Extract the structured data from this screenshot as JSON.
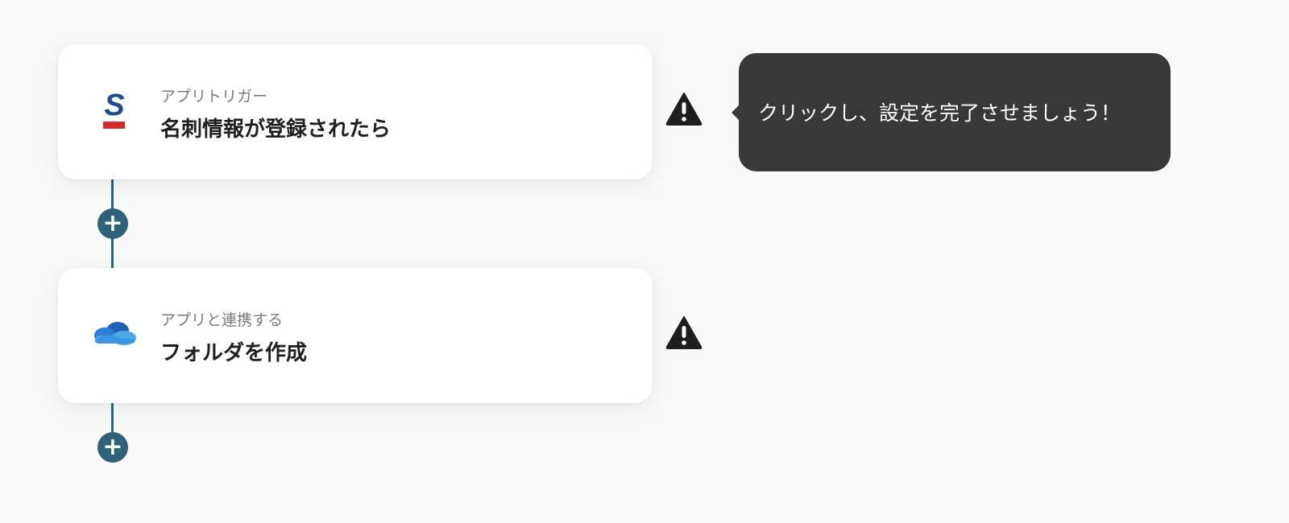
{
  "flow": {
    "steps": [
      {
        "type_label": "アプリトリガー",
        "title": "名刺情報が登録されたら",
        "app_icon": "sansan-logo-icon"
      },
      {
        "type_label": "アプリと連携する",
        "title": "フォルダを作成",
        "app_icon": "onedrive-cloud-icon"
      }
    ],
    "add_step_icon": "plus-icon",
    "warning_icon": "warning-triangle-icon"
  },
  "tooltip": {
    "text": "クリックし、設定を完了させましょう！"
  },
  "colors": {
    "background": "#f9f9f9",
    "connector": "#2f6279",
    "tooltip_bg": "#383838",
    "sansan_blue": "#1d4e8f",
    "sansan_red": "#d02d2d",
    "onedrive_blue": "#1f6fd0",
    "onedrive_light": "#4ea8e8"
  }
}
